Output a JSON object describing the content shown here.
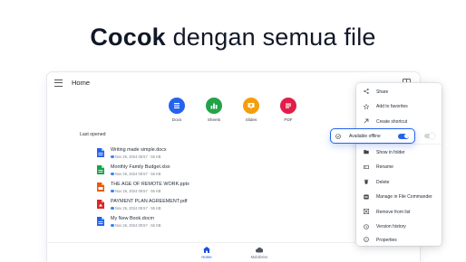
{
  "headline": {
    "bold": "Cocok",
    "rest": " dengan semua file"
  },
  "window": {
    "title": "Home"
  },
  "categories": [
    {
      "label": "Docs",
      "color": "#2563eb",
      "icon": "docs-icon"
    },
    {
      "label": "Sheets",
      "color": "#22a34a",
      "icon": "sheets-icon"
    },
    {
      "label": "Slides",
      "color": "#f59e0b",
      "icon": "slides-icon"
    },
    {
      "label": "PDF",
      "color": "#e11d48",
      "icon": "pdf-icon"
    }
  ],
  "section": {
    "last_opened": "Last opened"
  },
  "files": [
    {
      "name": "Writing made simple.docx",
      "meta": "Nov 26, 2024 09:57 · 55 KB",
      "type": "docx",
      "color": "#2563eb"
    },
    {
      "name": "Monthly Family Budget.xlsx",
      "meta": "Nov 26, 2024 09:57 · 55 KB",
      "type": "xlsx",
      "color": "#16a34a"
    },
    {
      "name": "THE AGE OF REMOTE WORK.pptx",
      "meta": "Nov 26, 2024 09:57 · 55 KB",
      "type": "pptx",
      "color": "#ea580c"
    },
    {
      "name": "PAYMENT PLAN AGREEMENT.pdf",
      "meta": "Nov 26, 2024 09:57 · 55 KB",
      "type": "pdf",
      "color": "#dc2626"
    },
    {
      "name": "My New Book.docm",
      "meta": "Nov 26, 2024 09:57 · 55 KB",
      "type": "docm",
      "color": "#2563eb"
    }
  ],
  "bottom_nav": [
    {
      "label": "Home",
      "active": true
    },
    {
      "label": "MobiDrive",
      "active": false
    }
  ],
  "menu": {
    "items": [
      {
        "label": "Share",
        "icon": "share-icon"
      },
      {
        "label": "Add to favorites",
        "icon": "star-icon"
      },
      {
        "label": "Create shortcut",
        "icon": "shortcut-icon"
      },
      {
        "label": "Available offline",
        "icon": "offline-icon",
        "toggle": true,
        "checked": true
      },
      {
        "label": "Show in folder",
        "icon": "folder-icon"
      },
      {
        "label": "Rename",
        "icon": "rename-icon"
      },
      {
        "label": "Delete",
        "icon": "trash-icon"
      },
      {
        "label": "Manage in File Commander",
        "icon": "file-commander-icon"
      },
      {
        "label": "Remove from list",
        "icon": "remove-icon"
      },
      {
        "label": "Version history",
        "icon": "history-icon"
      },
      {
        "label": "Properties",
        "icon": "info-icon"
      }
    ]
  }
}
